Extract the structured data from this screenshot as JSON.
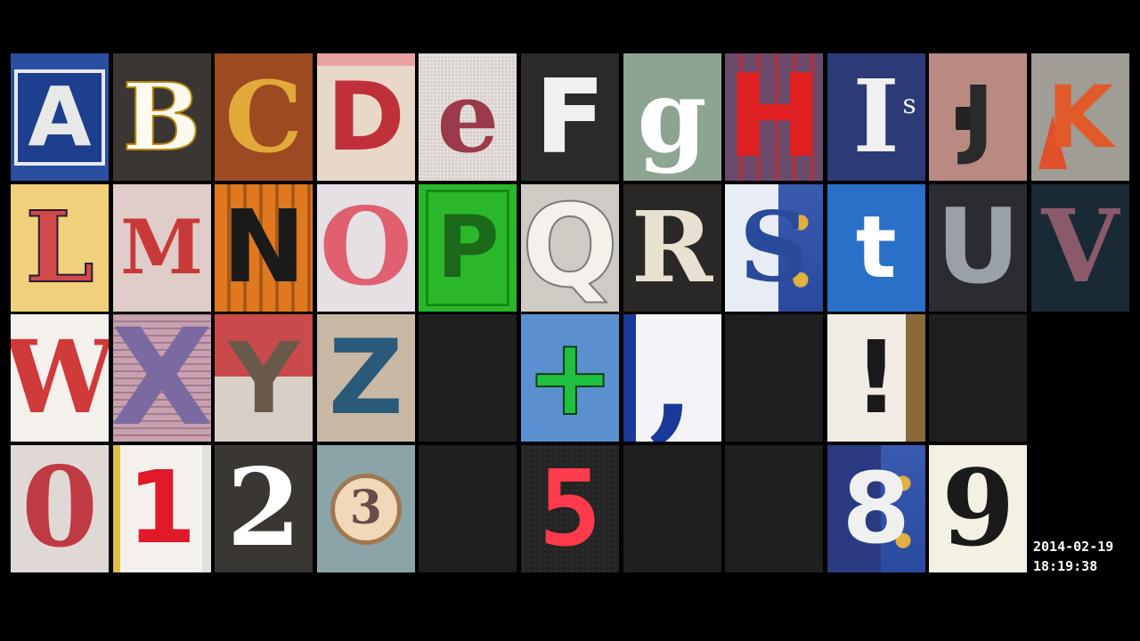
{
  "tiles": [
    {
      "name": "letter-a-tile",
      "glyph": "A",
      "bg": "#2b4fa0",
      "fg": "#e8e8e8",
      "font": "sans",
      "size": 92,
      "deco": "sign-frame"
    },
    {
      "name": "letter-b-tile",
      "glyph": "B",
      "bg": "#3a3633",
      "fg": "#fffaf0",
      "font": "serif",
      "size": 104,
      "outline": "#b8860b"
    },
    {
      "name": "letter-c-tile",
      "glyph": "C",
      "bg": "#9c4a22",
      "fg": "#e0a93a",
      "font": "serif",
      "size": 110
    },
    {
      "name": "letter-d-tile",
      "glyph": "D",
      "bg": "#e8d8c8",
      "fg": "#c0303a",
      "font": "sans",
      "size": 106,
      "deco": "top-stripe"
    },
    {
      "name": "letter-e-tile",
      "glyph": "e",
      "bg": "#d8d0cc",
      "fg": "#9a3a4a",
      "font": "serif",
      "size": 110,
      "deco": "cross-stitch"
    },
    {
      "name": "letter-f-tile",
      "glyph": "F",
      "bg": "#2a2a2a",
      "fg": "#f0f0f0",
      "font": "sans",
      "size": 112,
      "outline": "#f0f0f0"
    },
    {
      "name": "letter-g-tile",
      "glyph": "g",
      "bg": "#8ea492",
      "fg": "#ffffff",
      "font": "serif",
      "size": 112
    },
    {
      "name": "letter-h-tile",
      "glyph": "H",
      "bg": "#6a4a6a",
      "fg": "#e02020",
      "font": "sans",
      "size": 128,
      "deco": "bars"
    },
    {
      "name": "letter-i-tile",
      "glyph": "I",
      "bg": "#2c3a78",
      "fg": "#f0f0f0",
      "font": "serif",
      "size": 112,
      "sub": "s"
    },
    {
      "name": "letter-j-tile",
      "glyph": "J",
      "bg": "#b88a82",
      "fg": "#2a2a2a",
      "font": "sans",
      "size": 96,
      "deco": "wall-box"
    },
    {
      "name": "letter-k-tile",
      "glyph": "K",
      "bg": "#a09c96",
      "fg": "#e05a2a",
      "font": "sans",
      "size": 96,
      "deco": "cones"
    },
    {
      "name": "letter-l-tile",
      "glyph": "L",
      "bg": "#f0d07a",
      "fg": "#d04a4a",
      "font": "serif",
      "size": 110,
      "outline": "#2a1a3a"
    },
    {
      "name": "letter-m-tile",
      "glyph": "M",
      "bg": "#e0ccc8",
      "fg": "#c83a3a",
      "font": "serif",
      "size": 84
    },
    {
      "name": "letter-n-tile",
      "glyph": "N",
      "bg": "#e07820",
      "fg": "#1a1a1a",
      "font": "sans",
      "size": 112,
      "deco": "stripes"
    },
    {
      "name": "letter-o-tile",
      "glyph": "O",
      "bg": "#e4e0e4",
      "fg": "#e06070",
      "font": "serif",
      "size": 120
    },
    {
      "name": "letter-p-tile",
      "glyph": "P",
      "bg": "#2ab82a",
      "fg": "#1a6a1a",
      "font": "sans",
      "size": 96,
      "deco": "door"
    },
    {
      "name": "letter-q-tile",
      "glyph": "Q",
      "bg": "#cfcac4",
      "fg": "#f4f0ea",
      "font": "sans",
      "size": 128,
      "outline": "#7a7a7a"
    },
    {
      "name": "letter-r-tile",
      "glyph": "R",
      "bg": "#2a2826",
      "fg": "#e8e0d0",
      "font": "serif",
      "size": 110
    },
    {
      "name": "letter-s-tile",
      "glyph": "S",
      "bg": "#e8ecf4",
      "fg": "#2a4a9a",
      "font": "serif",
      "size": 108,
      "deco": "tile-pattern"
    },
    {
      "name": "letter-t-tile",
      "glyph": "t",
      "bg": "#2a70c8",
      "fg": "#ffffff",
      "font": "sans",
      "size": 96
    },
    {
      "name": "letter-u-tile",
      "glyph": "U",
      "bg": "#2a2c30",
      "fg": "#9aa0a8",
      "font": "sans",
      "size": 116
    },
    {
      "name": "letter-v-tile",
      "glyph": "V",
      "bg": "#1a2a34",
      "fg": "#8a5a6a",
      "font": "serif",
      "size": 112
    },
    {
      "name": "letter-w-tile",
      "glyph": "W",
      "bg": "#f4f0ec",
      "fg": "#d03a3a",
      "font": "serif",
      "size": 112
    },
    {
      "name": "letter-x-tile",
      "glyph": "X",
      "bg": "#c8a0b0",
      "fg": "#7a6aa0",
      "font": "sans",
      "size": 150,
      "deco": "slats"
    },
    {
      "name": "letter-y-tile",
      "glyph": "Y",
      "bg": "#c84a4a",
      "fg": "#6a5a4a",
      "font": "sans",
      "size": 110,
      "deco": "tree"
    },
    {
      "name": "letter-z-tile",
      "glyph": "Z",
      "bg": "#c8b8a4",
      "fg": "#2a5a7a",
      "font": "sans",
      "size": 116
    },
    {
      "name": "empty-tile",
      "empty": true
    },
    {
      "name": "plus-sign-tile",
      "glyph": "+",
      "bg": "#5a90d0",
      "fg": "#20c040",
      "font": "sans",
      "size": 120,
      "outline": "#104010"
    },
    {
      "name": "comma-tile",
      "glyph": ",",
      "bg": "#f4f4f8",
      "fg": "#1a3a9a",
      "font": "serif",
      "size": 150,
      "deco": "blue-edge"
    },
    {
      "name": "empty-tile",
      "empty": true
    },
    {
      "name": "exclamation-tile",
      "glyph": "!",
      "bg": "#f0ece4",
      "fg": "#1a1a1a",
      "font": "sans",
      "size": 112,
      "deco": "wood-edge"
    },
    {
      "name": "empty-tile",
      "empty": true
    },
    {
      "name": "blank-cell",
      "blank": true
    },
    {
      "name": "digit-0-tile",
      "glyph": "0",
      "bg": "#e0d8d4",
      "fg": "#c03a44",
      "font": "serif",
      "size": 124
    },
    {
      "name": "digit-1-tile",
      "glyph": "1",
      "bg": "#f4f0ec",
      "fg": "#e01a2a",
      "font": "sans",
      "size": 112,
      "deco": "calendar"
    },
    {
      "name": "digit-2-tile",
      "glyph": "2",
      "bg": "#3a3632",
      "fg": "#ffffff",
      "font": "serif",
      "size": 120
    },
    {
      "name": "digit-3-tile",
      "glyph": "3",
      "bg": "#8aa4a8",
      "fg": "#6a4a4a",
      "font": "serif",
      "size": 52,
      "deco": "plaque"
    },
    {
      "name": "empty-tile",
      "empty": true
    },
    {
      "name": "digit-5-tile",
      "glyph": "5",
      "bg": "#242424",
      "fg": "#ff3a4a",
      "font": "mono",
      "size": 118,
      "deco": "led"
    },
    {
      "name": "empty-tile",
      "empty": true
    },
    {
      "name": "empty-tile",
      "empty": true
    },
    {
      "name": "digit-8-tile",
      "glyph": "8",
      "bg": "#2a3a80",
      "fg": "#f0f0f0",
      "font": "sans",
      "size": 110,
      "deco": "tile-pattern"
    },
    {
      "name": "digit-9-tile",
      "glyph": "9",
      "bg": "#f4f0e4",
      "fg": "#1a1a1a",
      "font": "serif",
      "size": 118
    },
    {
      "name": "blank-cell",
      "blank": true
    }
  ],
  "timestamp": {
    "date": "2014-02-19",
    "time": "18:19:38"
  }
}
